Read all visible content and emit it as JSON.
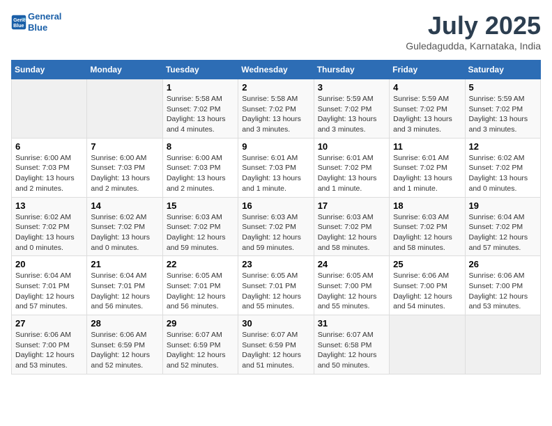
{
  "header": {
    "logo_line1": "General",
    "logo_line2": "Blue",
    "title": "July 2025",
    "subtitle": "Guledagudda, Karnataka, India"
  },
  "calendar": {
    "days_of_week": [
      "Sunday",
      "Monday",
      "Tuesday",
      "Wednesday",
      "Thursday",
      "Friday",
      "Saturday"
    ],
    "weeks": [
      [
        {
          "day": "",
          "info": ""
        },
        {
          "day": "",
          "info": ""
        },
        {
          "day": "1",
          "info": "Sunrise: 5:58 AM\nSunset: 7:02 PM\nDaylight: 13 hours and 4 minutes."
        },
        {
          "day": "2",
          "info": "Sunrise: 5:58 AM\nSunset: 7:02 PM\nDaylight: 13 hours and 3 minutes."
        },
        {
          "day": "3",
          "info": "Sunrise: 5:59 AM\nSunset: 7:02 PM\nDaylight: 13 hours and 3 minutes."
        },
        {
          "day": "4",
          "info": "Sunrise: 5:59 AM\nSunset: 7:02 PM\nDaylight: 13 hours and 3 minutes."
        },
        {
          "day": "5",
          "info": "Sunrise: 5:59 AM\nSunset: 7:02 PM\nDaylight: 13 hours and 3 minutes."
        }
      ],
      [
        {
          "day": "6",
          "info": "Sunrise: 6:00 AM\nSunset: 7:03 PM\nDaylight: 13 hours and 2 minutes."
        },
        {
          "day": "7",
          "info": "Sunrise: 6:00 AM\nSunset: 7:03 PM\nDaylight: 13 hours and 2 minutes."
        },
        {
          "day": "8",
          "info": "Sunrise: 6:00 AM\nSunset: 7:03 PM\nDaylight: 13 hours and 2 minutes."
        },
        {
          "day": "9",
          "info": "Sunrise: 6:01 AM\nSunset: 7:03 PM\nDaylight: 13 hours and 1 minute."
        },
        {
          "day": "10",
          "info": "Sunrise: 6:01 AM\nSunset: 7:02 PM\nDaylight: 13 hours and 1 minute."
        },
        {
          "day": "11",
          "info": "Sunrise: 6:01 AM\nSunset: 7:02 PM\nDaylight: 13 hours and 1 minute."
        },
        {
          "day": "12",
          "info": "Sunrise: 6:02 AM\nSunset: 7:02 PM\nDaylight: 13 hours and 0 minutes."
        }
      ],
      [
        {
          "day": "13",
          "info": "Sunrise: 6:02 AM\nSunset: 7:02 PM\nDaylight: 13 hours and 0 minutes."
        },
        {
          "day": "14",
          "info": "Sunrise: 6:02 AM\nSunset: 7:02 PM\nDaylight: 13 hours and 0 minutes."
        },
        {
          "day": "15",
          "info": "Sunrise: 6:03 AM\nSunset: 7:02 PM\nDaylight: 12 hours and 59 minutes."
        },
        {
          "day": "16",
          "info": "Sunrise: 6:03 AM\nSunset: 7:02 PM\nDaylight: 12 hours and 59 minutes."
        },
        {
          "day": "17",
          "info": "Sunrise: 6:03 AM\nSunset: 7:02 PM\nDaylight: 12 hours and 58 minutes."
        },
        {
          "day": "18",
          "info": "Sunrise: 6:03 AM\nSunset: 7:02 PM\nDaylight: 12 hours and 58 minutes."
        },
        {
          "day": "19",
          "info": "Sunrise: 6:04 AM\nSunset: 7:02 PM\nDaylight: 12 hours and 57 minutes."
        }
      ],
      [
        {
          "day": "20",
          "info": "Sunrise: 6:04 AM\nSunset: 7:01 PM\nDaylight: 12 hours and 57 minutes."
        },
        {
          "day": "21",
          "info": "Sunrise: 6:04 AM\nSunset: 7:01 PM\nDaylight: 12 hours and 56 minutes."
        },
        {
          "day": "22",
          "info": "Sunrise: 6:05 AM\nSunset: 7:01 PM\nDaylight: 12 hours and 56 minutes."
        },
        {
          "day": "23",
          "info": "Sunrise: 6:05 AM\nSunset: 7:01 PM\nDaylight: 12 hours and 55 minutes."
        },
        {
          "day": "24",
          "info": "Sunrise: 6:05 AM\nSunset: 7:00 PM\nDaylight: 12 hours and 55 minutes."
        },
        {
          "day": "25",
          "info": "Sunrise: 6:06 AM\nSunset: 7:00 PM\nDaylight: 12 hours and 54 minutes."
        },
        {
          "day": "26",
          "info": "Sunrise: 6:06 AM\nSunset: 7:00 PM\nDaylight: 12 hours and 53 minutes."
        }
      ],
      [
        {
          "day": "27",
          "info": "Sunrise: 6:06 AM\nSunset: 7:00 PM\nDaylight: 12 hours and 53 minutes."
        },
        {
          "day": "28",
          "info": "Sunrise: 6:06 AM\nSunset: 6:59 PM\nDaylight: 12 hours and 52 minutes."
        },
        {
          "day": "29",
          "info": "Sunrise: 6:07 AM\nSunset: 6:59 PM\nDaylight: 12 hours and 52 minutes."
        },
        {
          "day": "30",
          "info": "Sunrise: 6:07 AM\nSunset: 6:59 PM\nDaylight: 12 hours and 51 minutes."
        },
        {
          "day": "31",
          "info": "Sunrise: 6:07 AM\nSunset: 6:58 PM\nDaylight: 12 hours and 50 minutes."
        },
        {
          "day": "",
          "info": ""
        },
        {
          "day": "",
          "info": ""
        }
      ]
    ]
  }
}
